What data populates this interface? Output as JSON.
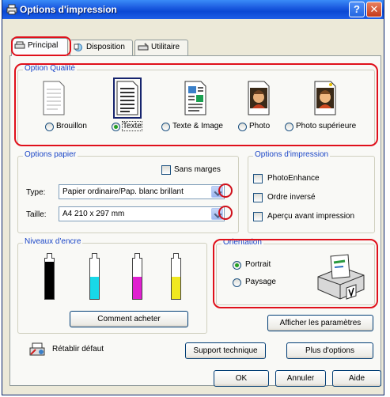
{
  "window": {
    "title": "Options d'impression",
    "help_glyph": "?",
    "close_glyph": "✕"
  },
  "tabs": [
    {
      "label": "Principal",
      "icon": "printer-icon"
    },
    {
      "label": "Disposition",
      "icon": "layout-icon"
    },
    {
      "label": "Utilitaire",
      "icon": "tools-icon"
    }
  ],
  "quality": {
    "title": "Option Qualité",
    "options": [
      {
        "label": "Brouillon",
        "selected": false,
        "icon": "draft-page-icon"
      },
      {
        "label": "Texte",
        "selected": true,
        "icon": "text-page-icon"
      },
      {
        "label": "Texte & Image",
        "selected": false,
        "icon": "text-image-page-icon"
      },
      {
        "label": "Photo",
        "selected": false,
        "icon": "photo-icon"
      },
      {
        "label": "Photo supérieure",
        "selected": false,
        "icon": "best-photo-icon"
      }
    ]
  },
  "paper": {
    "title": "Options papier",
    "borderless_label": "Sans marges",
    "borderless_checked": false,
    "type_label": "Type:",
    "type_value": "Papier ordinaire/Pap. blanc brillant",
    "size_label": "Taille:",
    "size_value": "A4 210 x 297 mm"
  },
  "print_options": {
    "title": "Options d'impression",
    "items": [
      {
        "label": "PhotoEnhance",
        "checked": false
      },
      {
        "label": "Ordre inversé",
        "checked": false
      },
      {
        "label": "Aperçu avant impression",
        "checked": false
      }
    ]
  },
  "ink": {
    "title": "Niveaux d'encre",
    "cartridges": [
      {
        "color": "#000000",
        "level": 0.92
      },
      {
        "color": "#18D8E8",
        "level": 0.55
      },
      {
        "color": "#E020D0",
        "level": 0.55
      },
      {
        "color": "#F0E820",
        "level": 0.55
      }
    ],
    "buy_button": "Comment acheter"
  },
  "orientation": {
    "title": "Orientation",
    "options": [
      {
        "label": "Portrait",
        "selected": true
      },
      {
        "label": "Paysage",
        "selected": false
      }
    ]
  },
  "buttons": {
    "show_settings": "Afficher les paramètres",
    "restore_defaults": "Rétablir défaut",
    "support": "Support technique",
    "more_options": "Plus d'options",
    "ok": "OK",
    "cancel": "Annuler",
    "help": "Aide"
  },
  "colors": {
    "highlight": "#E0101B",
    "group_title": "#1B46C7",
    "titlebar": "#0A48D4"
  }
}
